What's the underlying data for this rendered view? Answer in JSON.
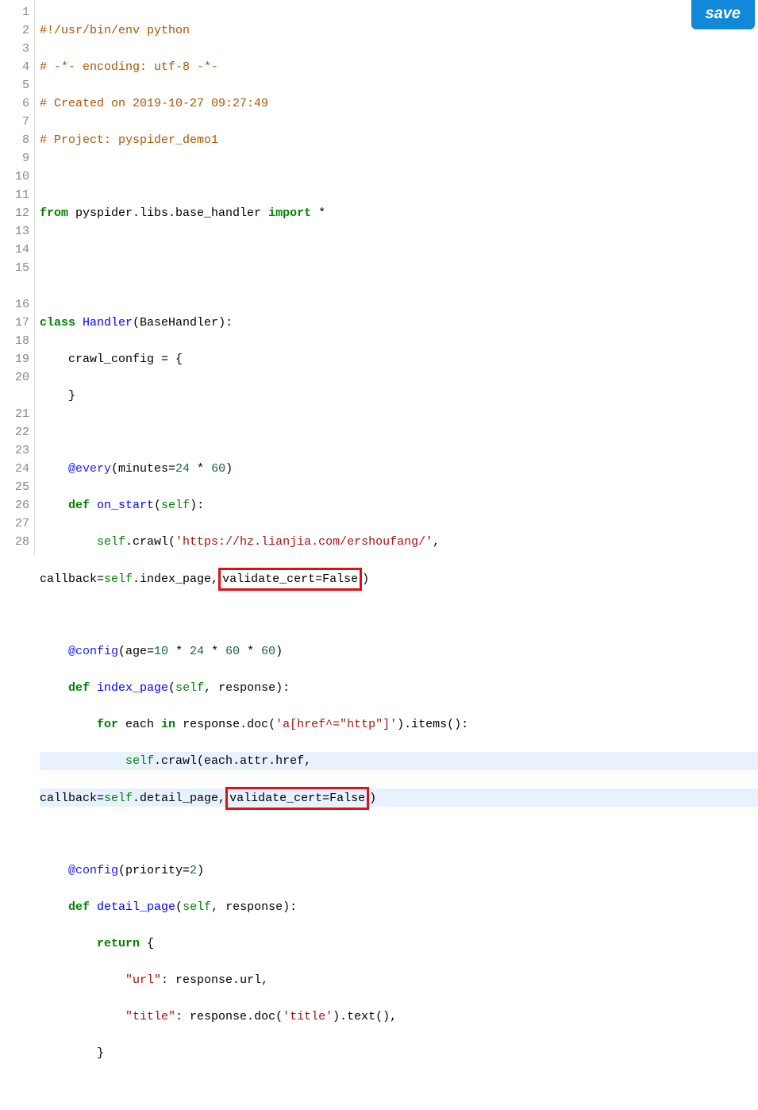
{
  "save_button": "save",
  "line_numbers": [
    "1",
    "2",
    "3",
    "4",
    "5",
    "6",
    "7",
    "8",
    "9",
    "10",
    "11",
    "12",
    "13",
    "14",
    "15",
    "",
    "16",
    "17",
    "18",
    "19",
    "20",
    "",
    "21",
    "22",
    "23",
    "24",
    "25",
    "26",
    "27",
    "28"
  ],
  "code": {
    "l1_shebang": "#!/usr/bin/env python",
    "l2_encoding": "# -*- encoding: utf-8 -*-",
    "l3_created": "# Created on 2019-10-27 09:27:49",
    "l4_project": "# Project: pyspider_demo1",
    "l6_from": "from",
    "l6_module": " pyspider.libs.base_handler ",
    "l6_import": "import",
    "l6_star": " *",
    "l9_class": "class",
    "l9_name": " Handler",
    "l9_paren_open": "(",
    "l9_base": "BaseHandler",
    "l9_paren_close": "):",
    "l10_crawl_config": "    crawl_config = {",
    "l11_close": "    }",
    "l13_every": "    @every",
    "l13_args_open": "(minutes=",
    "l13_24": "24",
    "l13_mult": " * ",
    "l13_60": "60",
    "l13_close": ")",
    "l14_def": "    def",
    "l14_name": " on_start",
    "l14_paren": "(",
    "l14_self": "self",
    "l14_end": "):",
    "l15_indent": "        ",
    "l15_self": "self",
    "l15_crawl": ".crawl(",
    "l15_url": "'https://hz.lianjia.com/ershoufang/'",
    "l15_comma": ", ",
    "l15w_callback": "callback=",
    "l15w_self": "self",
    "l15w_index": ".index_page,",
    "l15w_validate": "validate_cert=False",
    "l15w_close": ")",
    "l17_config": "    @config",
    "l17_args_open": "(age=",
    "l17_10": "10",
    "l17_m1": " * ",
    "l17_24": "24",
    "l17_m2": " * ",
    "l17_60a": "60",
    "l17_m3": " * ",
    "l17_60b": "60",
    "l17_close": ")",
    "l18_def": "    def",
    "l18_name": " index_page",
    "l18_paren": "(",
    "l18_self": "self",
    "l18_comma": ", response):",
    "l19_indent": "        ",
    "l19_for": "for",
    "l19_each": " each ",
    "l19_in": "in",
    "l19_resp": " response.doc(",
    "l19_sel": "'a[href^=\"http\"]'",
    "l19_items": ").items():",
    "l20_indent": "            ",
    "l20_self": "self",
    "l20_crawl": ".crawl(each.attr.href, ",
    "l20w_callback": "callback=",
    "l20w_self": "self",
    "l20w_detail": ".detail_page,",
    "l20w_validate": "validate_cert=False",
    "l20w_close": ")",
    "l22_config": "    @config",
    "l22_args": "(priority=",
    "l22_2": "2",
    "l22_close": ")",
    "l23_def": "    def",
    "l23_name": " detail_page",
    "l23_paren": "(",
    "l23_self": "self",
    "l23_rest": ", response):",
    "l24_return": "        return",
    "l24_brace": " {",
    "l25_indent": "            ",
    "l25_key": "\"url\"",
    "l25_val": ": response.url,",
    "l26_indent": "            ",
    "l26_key": "\"title\"",
    "l26_val": ": response.doc(",
    "l26_title": "'title'",
    "l26_text": ").text(),",
    "l27_close": "        }"
  }
}
